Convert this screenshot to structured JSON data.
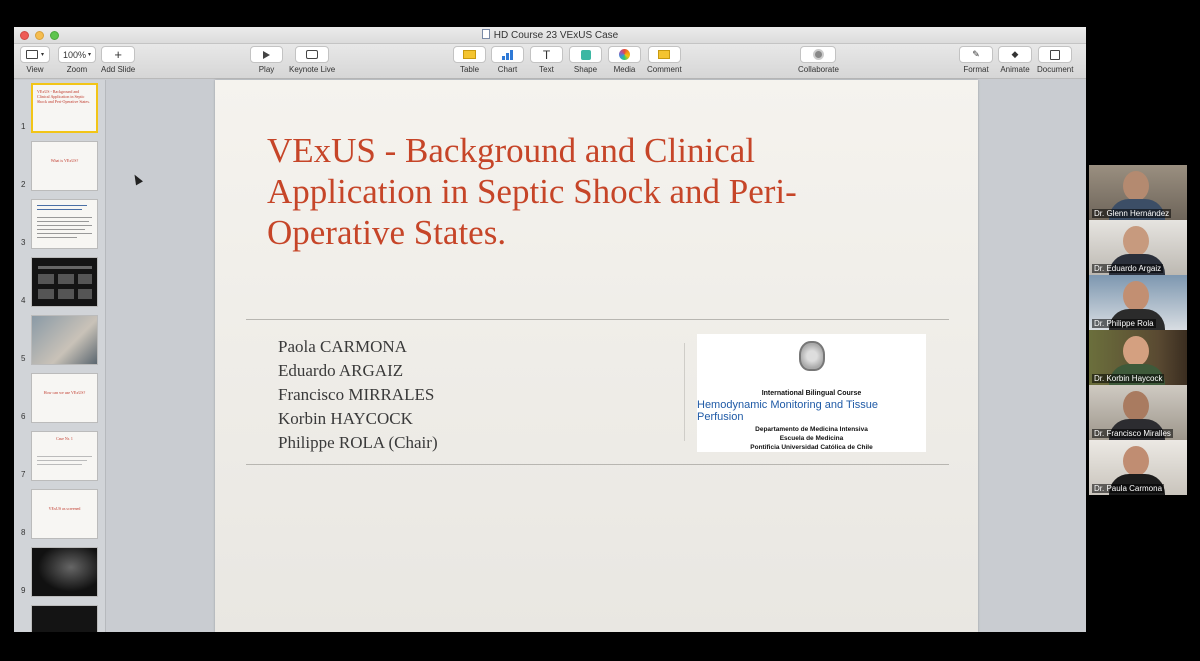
{
  "window": {
    "title": "HD Course 23 VExUS Case"
  },
  "toolbar": {
    "view": "View",
    "zoom_value": "100%",
    "zoom": "Zoom",
    "add_slide": "Add Slide",
    "play": "Play",
    "keynote_live": "Keynote Live",
    "table": "Table",
    "chart": "Chart",
    "text": "Text",
    "text_glyph": "T",
    "shape": "Shape",
    "media": "Media",
    "comment": "Comment",
    "collaborate": "Collaborate",
    "format": "Format",
    "animate": "Animate",
    "document": "Document"
  },
  "slides": [
    {
      "number": "1",
      "text": "VExUS - Background and Clinical Application in Septic Shock and Peri-Operative States."
    },
    {
      "number": "2",
      "text": "What is VExUS?"
    },
    {
      "number": "3",
      "text": ""
    },
    {
      "number": "4",
      "text": ""
    },
    {
      "number": "5",
      "text": ""
    },
    {
      "number": "6",
      "text": "How can we use VExUS?"
    },
    {
      "number": "7",
      "text": "Case Nr. 1"
    },
    {
      "number": "8",
      "text": "VExUS as screened"
    },
    {
      "number": "9",
      "text": ""
    }
  ],
  "slide": {
    "title": "VExUS - Background and Clinical Application in Septic Shock and Peri-Operative States.",
    "authors": [
      "Paola CARMONA",
      "Eduardo ARGAIZ",
      "Francisco MIRRALES",
      "Korbin HAYCOCK",
      "Philippe ROLA (Chair)"
    ],
    "logo": {
      "line1": "International Bilingual Course",
      "line2": "Hemodynamic Monitoring and Tissue Perfusion",
      "line3": "Departamento de Medicina Intensiva",
      "line4": "Escuela de Medicina",
      "line5": "Pontificia Universidad Católica de Chile"
    }
  },
  "participants": [
    {
      "name": "Dr. Glenn Hernández"
    },
    {
      "name": "Dr. Eduardo Argaiz"
    },
    {
      "name": "Dr. Philippe Rola"
    },
    {
      "name": "Dr. Korbin Haycock"
    },
    {
      "name": "Dr. Francisco Miralles"
    },
    {
      "name": "Dr. Paula Carmona"
    }
  ],
  "colors": {
    "title_red": "#c64528",
    "selection_yellow": "#f2c517",
    "logo_blue": "#1f5aa6"
  }
}
